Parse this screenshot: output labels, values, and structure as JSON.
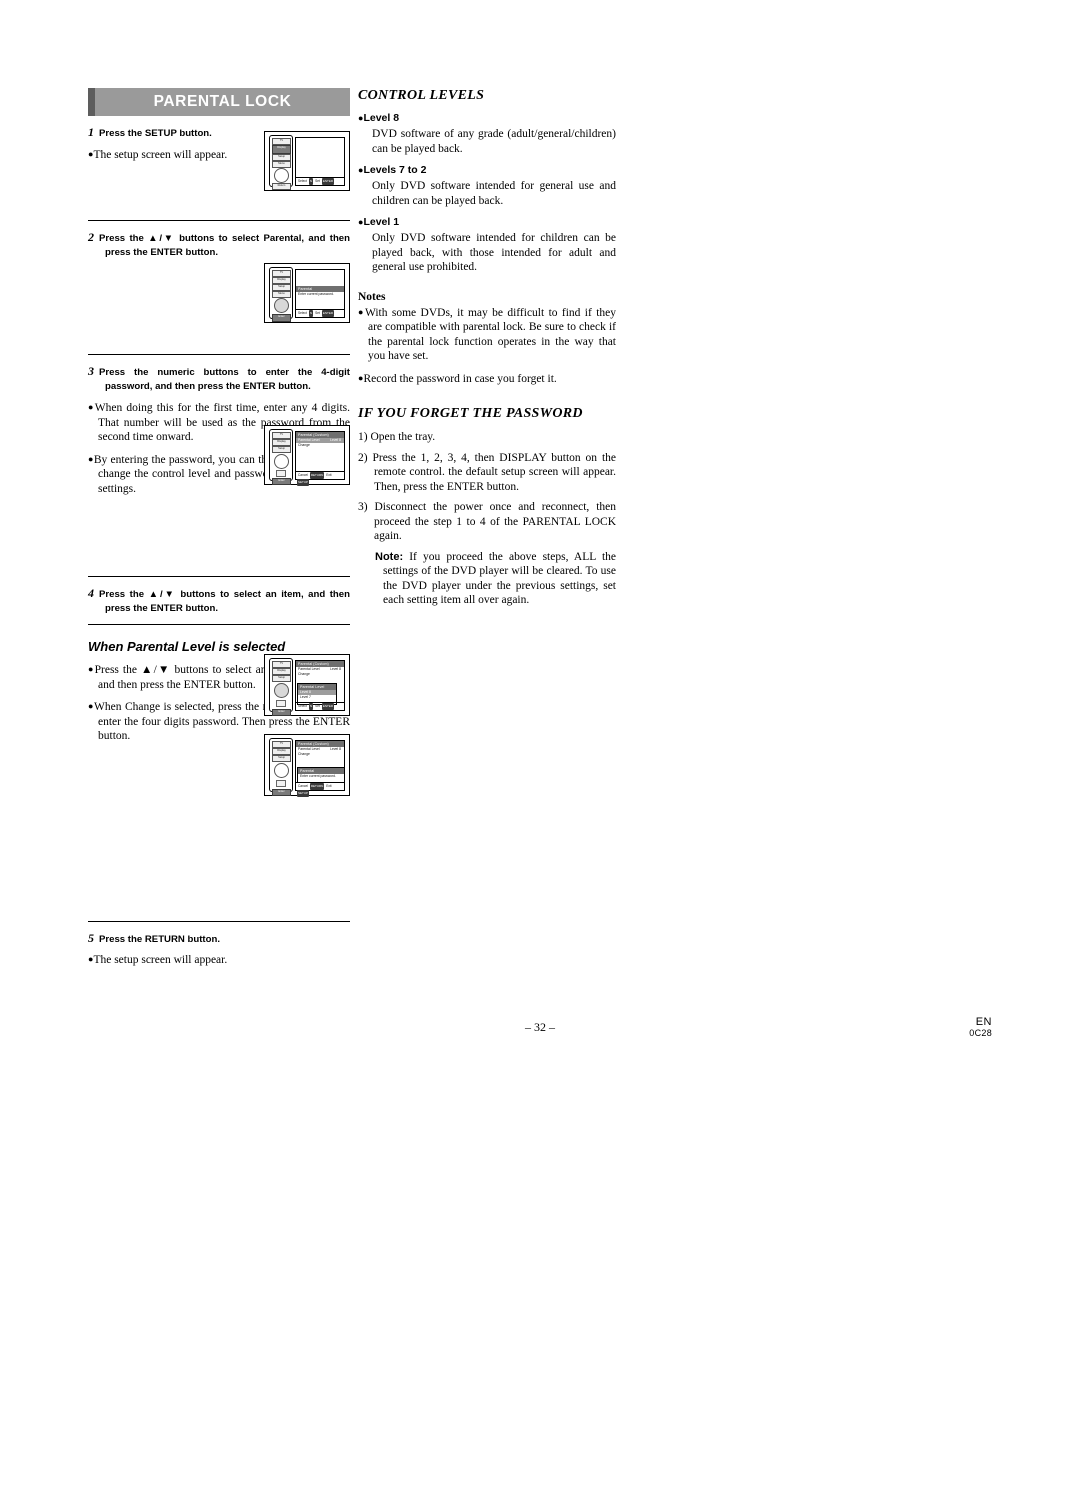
{
  "left": {
    "title": "PARENTAL LOCK",
    "steps": [
      {
        "num": "1",
        "text": "Press the SETUP button."
      },
      {
        "num": "2",
        "text": "Press the ▲/▼ buttons to select Parental, and then press the ENTER button."
      },
      {
        "num": "3",
        "text": "Press the numeric buttons to enter the 4-digit password, and then press the ENTER button."
      },
      {
        "num": "4",
        "text": "Press the ▲/▼ buttons to select an item, and then press the ENTER button."
      },
      {
        "num": "5",
        "text": "Press the RETURN button."
      }
    ],
    "bullets": {
      "after1": "The setup screen will appear.",
      "after3a": "When doing this for the first time, enter any 4 digits. That number will be used as the password from the second time onward.",
      "after3b": "By entering the password, you can then change the control level and password settings.",
      "after5": "The setup screen will appear."
    },
    "subhead": "When Parental Level is selected",
    "sub_bullets": [
      "Press the ▲/▼ buttons to select an item from  8 to 1 and then press the ENTER button.",
      "When Change is selected, press the numeric buttons to enter the four digits password. Then press the ENTER button."
    ]
  },
  "right": {
    "control_levels_head": "CONTROL LEVELS",
    "levels": [
      {
        "label": "Level 8",
        "text": "DVD software of any grade (adult/general/children) can be played back."
      },
      {
        "label": "Levels 7 to 2",
        "text": "Only DVD software intended for general use and children can be played back."
      },
      {
        "label": "Level 1",
        "text": "Only DVD software intended for children can be played back, with those intended for adult and general use prohibited."
      }
    ],
    "notes_head": "Notes",
    "notes": [
      "With some DVDs, it may be difficult to find if they are compatible with parental lock. Be sure to check if the parental lock function operates in the way that you have set.",
      "Record the password in case you forget it."
    ],
    "forget_head": "IF YOU FORGET THE PASSWORD",
    "forget_steps": [
      "1) Open the tray.",
      "2) Press the 1, 2, 3, 4, then DISPLAY button on the remote control. the default setup screen will appear. Then, press the ENTER button.",
      "3) Disconnect the power once and reconnect, then proceed the step 1 to 4 of the PARENTAL LOCK again."
    ],
    "note_label": "Note:",
    "note_text": "If  you proceed the above steps, ALL the settings of the DVD player will be cleared. To use the DVD player under the previous settings, set each setting item all over again."
  },
  "figures": {
    "remote_buttons": [
      "Display",
      "Setup",
      "Return",
      "Enter"
    ],
    "osd": {
      "fig1": {
        "rows": []
      },
      "fig2": {
        "title": "Parental",
        "row": "Enter current password."
      },
      "fig3": {
        "title": "Parental (Custom)",
        "rows": [
          "Parental Level",
          "Change"
        ],
        "value": "Level 8"
      },
      "fig4": {
        "title": "Parental (Custom)",
        "rows": [
          "Parental Level",
          "Change"
        ],
        "value": "Level 8",
        "sub_title": "Parental Level",
        "sub_rows": [
          "Level 8",
          "Level 7",
          "Level 6"
        ]
      },
      "fig5": {
        "title": "Parental (Custom)",
        "rows": [
          "Parental Level",
          "Change"
        ],
        "value": "Level 8",
        "sub_title": "Parental",
        "sub_row": "Enter current password."
      },
      "bar": {
        "select": "Select",
        "set": "Set",
        "cancel": "Cancel",
        "exit": "Exit",
        "keys": [
          "ENTER",
          "SETUP",
          "RETURN"
        ]
      }
    }
  },
  "footer": {
    "page": "– 32 –",
    "lang": "EN",
    "code": "0C28"
  }
}
